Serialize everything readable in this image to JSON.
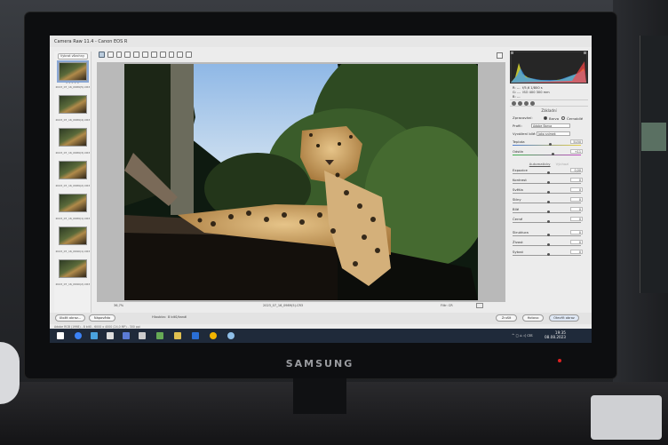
{
  "window": {
    "title": "Camera Raw 11.4  -  Canon EOS R"
  },
  "filmstrip": {
    "select_all": "Vybrat všechny",
    "thumbnails": [
      {
        "name": "2023_07_16_0989(5).CR3",
        "stars": "★★★★★"
      },
      {
        "name": "2023_07_16_0989(4).CR3",
        "stars": ""
      },
      {
        "name": "2023_07_16_0989(3).CR3",
        "stars": ""
      },
      {
        "name": "2023_07_16_0989(2).CR3",
        "stars": ""
      },
      {
        "name": "2023_07_16_0989(1).CR3",
        "stars": ""
      },
      {
        "name": "2023_07_16_0990(1).CR3",
        "stars": ""
      },
      {
        "name": "2023_07_16_0990(2).CR3",
        "stars": ""
      }
    ]
  },
  "canvas": {
    "zoom": "36,7%",
    "filename": "2023_07_16_0989(5).CR3",
    "filter": "Filtr: CR"
  },
  "readouts": {
    "r": "R:  ---",
    "g": "G:  ---",
    "b": "B:  ---",
    "lens": "f/5,6   1/800 s",
    "iso": "ISO 400   300 mm"
  },
  "panel": {
    "title": "Základní",
    "treatment_label": "Zpracování:",
    "treatment_color": "Barva",
    "treatment_bw": "Černobílé",
    "profile_label": "Profil:",
    "profile_value": "Adobe Barva",
    "wb_label": "Vyvážení bílé:",
    "wb_value": "Jako snímek",
    "temp_label": "Teplota",
    "temp_value": "5150",
    "tint_label": "Odstín",
    "tint_value": "+11",
    "auto_label": "Automaticky",
    "default_label": "Výchozí",
    "sliders": [
      {
        "label": "Expozice",
        "value": "0,00",
        "pos": 0.5
      },
      {
        "label": "Kontrast",
        "value": "0",
        "pos": 0.5
      },
      {
        "label": "Světla",
        "value": "0",
        "pos": 0.5
      },
      {
        "label": "Stíny",
        "value": "0",
        "pos": 0.5
      },
      {
        "label": "Bílé",
        "value": "0",
        "pos": 0.5
      },
      {
        "label": "Černé",
        "value": "0",
        "pos": 0.5
      }
    ],
    "sliders2": [
      {
        "label": "Struktura",
        "value": "0",
        "pos": 0.5
      },
      {
        "label": "Živost",
        "value": "0",
        "pos": 0.5
      },
      {
        "label": "Sytost",
        "value": "0",
        "pos": 0.5
      }
    ]
  },
  "bottom": {
    "save_image": "Uložit obraz...",
    "help": "Nápověda",
    "workflow_a": "Hloubka:",
    "workflow_b": "8 bitů/kanál",
    "cancel": "Zrušit",
    "done": "Hotovo",
    "open": "Otevřít obraz",
    "workflow_link": "Adobe RGB (1998) - 8 bitů - 6000 x 4000 (24,0 MP) - 300 ppi"
  },
  "taskbar": {
    "time": "19:35",
    "date": "08.08.2023",
    "tray": "^ ◻ ⌂ ◁ ᴄᴇs"
  },
  "monitor": {
    "brand": "SAMSUNG"
  }
}
